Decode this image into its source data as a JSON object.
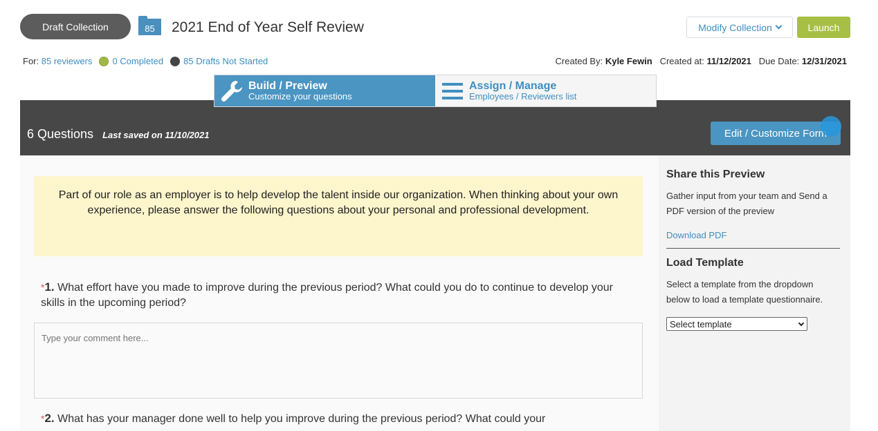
{
  "header": {
    "status_pill": "Draft Collection",
    "count_badge": "85",
    "title": "2021 End of Year Self Review",
    "modify_label": "Modify Collection",
    "launch_label": "Launch"
  },
  "meta": {
    "for_label": "For:",
    "reviewers": "85 reviewers",
    "completed": "0 Completed",
    "not_started": "85 Drafts Not Started",
    "created_by_label": "Created By:",
    "created_by": "Kyle Fewin",
    "created_at_label": "Created at:",
    "created_at": "11/12/2021",
    "due_label": "Due Date:",
    "due_date": "12/31/2021"
  },
  "tabs": [
    {
      "title": "Build / Preview",
      "subtitle": "Customize your questions",
      "icon": "wrench-icon",
      "active": true
    },
    {
      "title": "Assign / Manage",
      "subtitle": "Employees / Reviewers list",
      "icon": "list-icon",
      "active": false
    }
  ],
  "toolbar": {
    "questions_count": "6 Questions",
    "last_saved": "Last saved on 11/10/2021",
    "edit_label": "Edit / Customize Form"
  },
  "form": {
    "intro": "Part of our role as an employer is to help develop the talent inside our organization. When thinking about your own experience, please answer the following questions about your personal and professional development.",
    "questions": [
      {
        "required": "*",
        "number": "1.",
        "text": "What effort have you made to improve during the previous period? What could you do to continue to develop your skills in the upcoming period?",
        "placeholder": "Type your comment here..."
      },
      {
        "required": "*",
        "number": "2.",
        "text": "What has your manager done well to help you improve during the previous period? What could your"
      }
    ]
  },
  "sidebar": {
    "share_heading": "Share this Preview",
    "share_text": "Gather input from your team and Send a PDF version of the preview",
    "download_label": "Download PDF",
    "template_heading": "Load Template",
    "template_text": "Select a template from the dropdown below to load a template questionnaire.",
    "template_select": "Select template"
  },
  "colors": {
    "accent": "#4a95c2",
    "launch": "#a8bf45",
    "band": "#474747",
    "intro_bg": "#fdf5cc"
  }
}
